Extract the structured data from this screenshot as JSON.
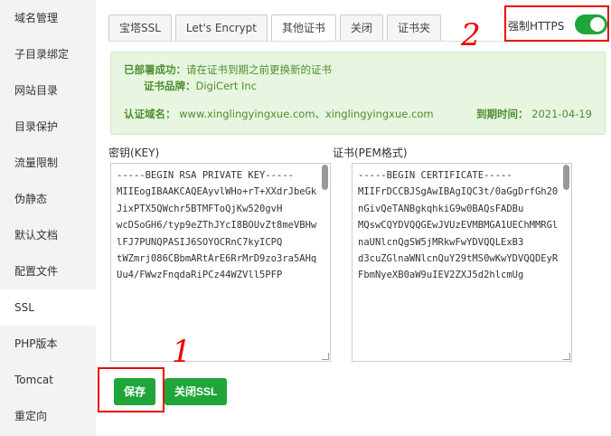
{
  "sidebar": {
    "items": [
      {
        "label": "域名管理"
      },
      {
        "label": "子目录绑定"
      },
      {
        "label": "网站目录"
      },
      {
        "label": "目录保护"
      },
      {
        "label": "流量限制"
      },
      {
        "label": "伪静态"
      },
      {
        "label": "默认文档"
      },
      {
        "label": "配置文件"
      },
      {
        "label": "SSL"
      },
      {
        "label": "PHP版本"
      },
      {
        "label": "Tomcat"
      },
      {
        "label": "重定向"
      }
    ],
    "active_index": 8
  },
  "tabs": [
    {
      "label": "宝塔SSL"
    },
    {
      "label": "Let's Encrypt"
    },
    {
      "label": "其他证书"
    },
    {
      "label": "关闭"
    },
    {
      "label": "证书夹"
    }
  ],
  "force_https": {
    "label": "强制HTTPS",
    "enabled": true
  },
  "info": {
    "status_label": "已部署成功：",
    "status_text": "请在证书到期之前更换新的证书",
    "brand_label": "证书品牌：",
    "brand_value": "DigiCert Inc",
    "domains_label": "认证域名：",
    "domains_value": "www.xinglingyingxue.com、xinglingyingxue.com",
    "expiry_label": "到期时间：",
    "expiry_value": "2021-04-19"
  },
  "key": {
    "label": "密钥(KEY)",
    "content": "-----BEGIN RSA PRIVATE KEY-----\nMIIEogIBAAKCAQEAyvlWHo+rT+XXdrJbeGkJixPTX5QWchr5BTMFToQjKw520gvH\nwcDSoGH6/typ9eZThJYcI8BOUvZt8meVBHwlFJ7PUNQPASIJ6SOYOCRnC7kyICPQ\ntWZmrj086CBbmARtArE6RrMrD9zo3ra5AHqUu4/FWwzFnqdaRiPCz44WZVll5PFP"
  },
  "cert": {
    "label": "证书(PEM格式)",
    "content": "-----BEGIN CERTIFICATE-----\nMIIFrDCCBJSgAwIBAgIQC3t/0aGgDrfGh20nGivQeTANBgkqhkiG9w0BAQsFADBu\nMQswCQYDVQQGEwJVUzEVMBMGA1UEChMMRGlnaUNlcnQgSW5jMRkwFwYDVQQLExB3\nd3cuZGlnaWNlcnQuY29tMS0wKwYDVQQDEyRFbmNyeXB0aW9uIEV2ZXJ5d2hlcmUg"
  },
  "buttons": {
    "save": "保存",
    "close_ssl": "关闭SSL"
  },
  "annotations": {
    "one": "1",
    "two": "2"
  },
  "colors": {
    "accent": "#20a53a",
    "annotation": "#e00000",
    "info_bg": "#e8f5e1",
    "info_text": "#4c8f2e"
  }
}
